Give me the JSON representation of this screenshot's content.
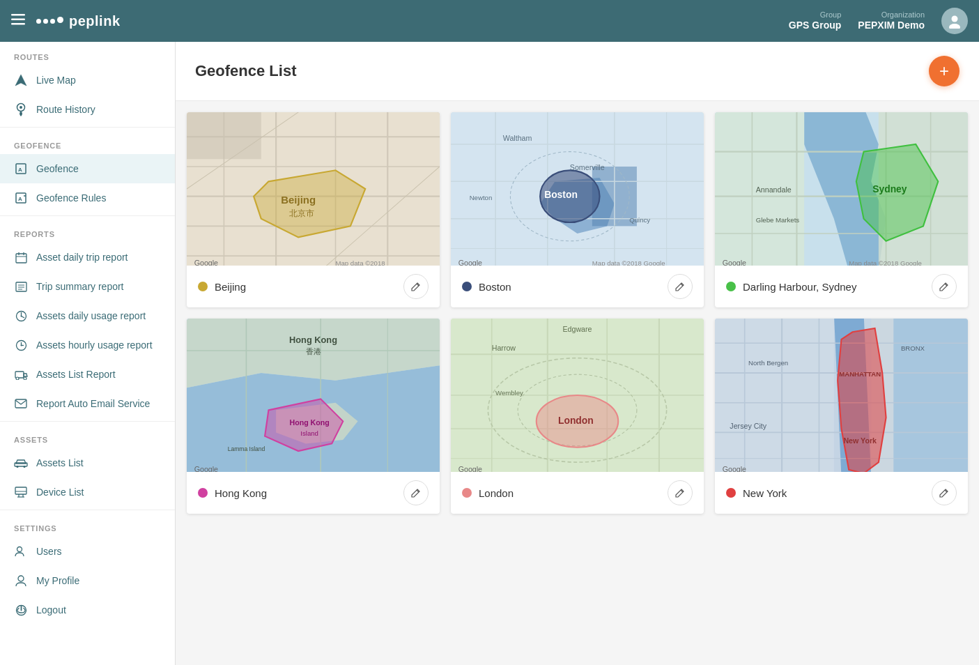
{
  "header": {
    "menu_label": "☰",
    "logo_text": "peplink",
    "group_label": "Group",
    "group_value": "GPS Group",
    "org_label": "Organization",
    "org_value": "PEPXIM Demo"
  },
  "sidebar": {
    "routes_label": "Routes",
    "geofence_label": "Geofence",
    "reports_label": "Reports",
    "assets_label": "Assets",
    "settings_label": "Settings",
    "items": {
      "live_map": "Live Map",
      "route_history": "Route History",
      "geofence": "Geofence",
      "geofence_rules": "Geofence Rules",
      "asset_daily_trip": "Asset daily trip report",
      "trip_summary": "Trip summary report",
      "assets_daily_usage": "Assets daily usage report",
      "assets_hourly_usage": "Assets hourly usage report",
      "assets_list_report": "Assets List Report",
      "report_auto_email": "Report Auto Email Service",
      "assets_list": "Assets List",
      "device_list": "Device List",
      "users": "Users",
      "my_profile": "My Profile",
      "logout": "Logout"
    }
  },
  "page": {
    "title": "Geofence List",
    "add_button_label": "+"
  },
  "geofences": [
    {
      "id": "beijing",
      "name": "Beijing",
      "color": "#c8a832",
      "map_class": "map-beijing"
    },
    {
      "id": "boston",
      "name": "Boston",
      "color": "#3a4e7a",
      "map_class": "map-boston"
    },
    {
      "id": "sydney",
      "name": "Darling Harbour, Sydney",
      "color": "#48c048",
      "map_class": "map-sydney"
    },
    {
      "id": "hongkong",
      "name": "Hong Kong",
      "color": "#d040a0",
      "map_class": "map-hongkong"
    },
    {
      "id": "london",
      "name": "London",
      "color": "#e88888",
      "map_class": "map-london"
    },
    {
      "id": "newyork",
      "name": "New York",
      "color": "#e04040",
      "map_class": "map-newyork"
    }
  ],
  "icons": {
    "menu": "☰",
    "navigation": "◈",
    "location_pin": "⊙",
    "geofence_icon": "⊞",
    "rules_icon": "⊟",
    "calendar": "📅",
    "trip": "≡",
    "clock_circle": "◷",
    "clock": "⏱",
    "truck": "🚚",
    "envelope": "✉",
    "car": "🚗",
    "device": "▤",
    "users_icon": "👤",
    "profile": "👤",
    "logout": "⏻",
    "pencil": "✎"
  }
}
